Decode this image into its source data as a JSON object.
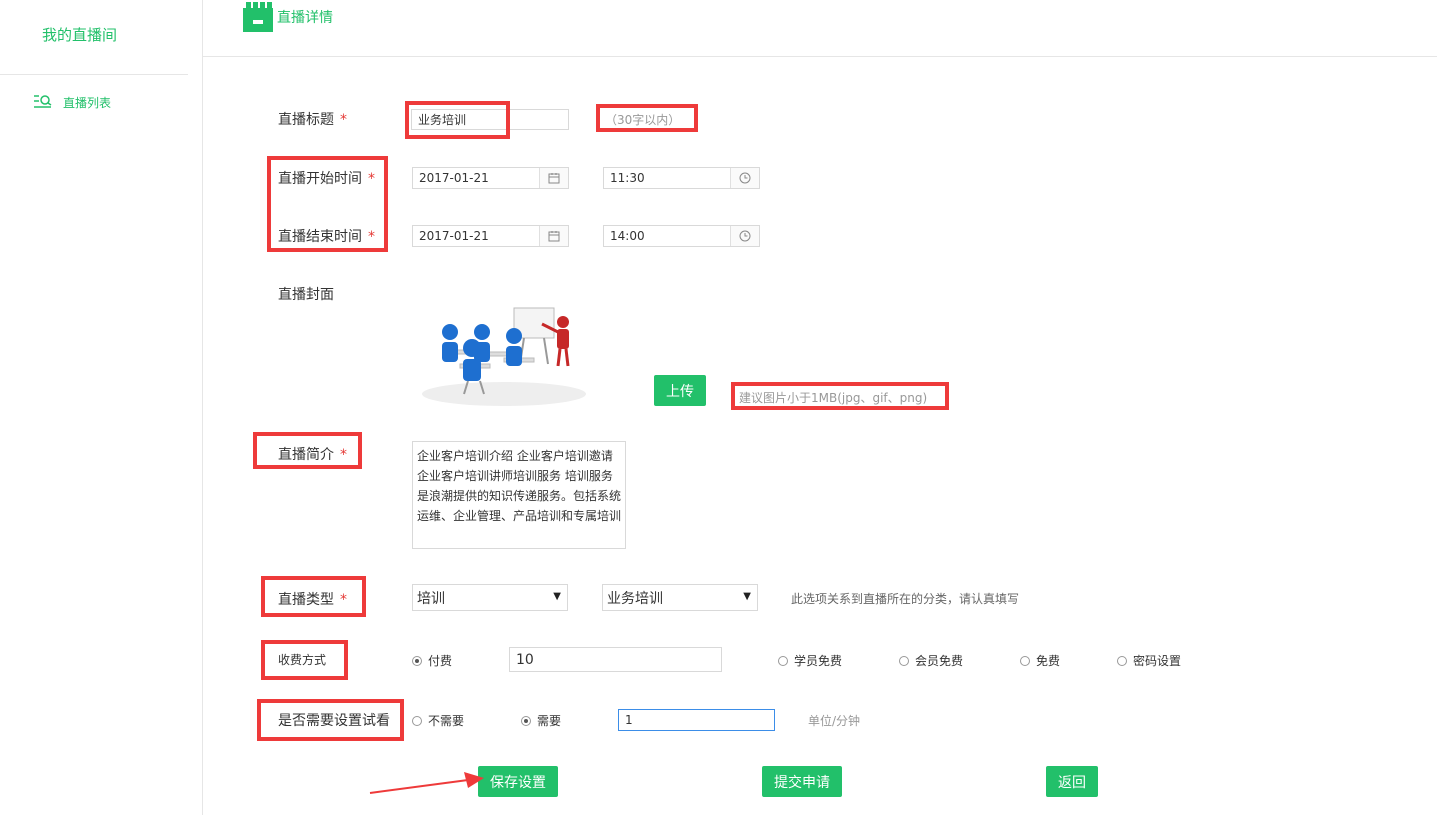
{
  "sidebar": {
    "title": "我的直播间",
    "items": [
      {
        "label": "直播列表",
        "icon": "search-list-icon"
      }
    ]
  },
  "header": {
    "title": "直播详情",
    "icon": "store-icon"
  },
  "form": {
    "title_label": "直播标题",
    "title_value": "业务培训",
    "title_hint": "（30字以内）",
    "start_label": "直播开始时间",
    "start_date": "2017-01-21",
    "start_time": "11:30",
    "end_label": "直播结束时间",
    "end_date": "2017-01-21",
    "end_time": "14:00",
    "cover_label": "直播封面",
    "upload_button": "上传",
    "upload_hint": "建议图片小于1MB(jpg、gif、png)",
    "intro_label": "直播简介",
    "intro_lines": [
      "企业客户培训介绍 企业客户培训邀请",
      "企业客户培训讲师培训服务 培训服务",
      "是浪潮提供的知识传递服务。包括系统",
      "运维、企业管理、产品培训和专属培训"
    ],
    "type_label": "直播类型",
    "type_value": "培训",
    "subtype_value": "业务培训",
    "type_hint": "此选项关系到直播所在的分类，请认真填写",
    "fee_label": "收费方式",
    "fee_options": [
      "付费",
      "学员免费",
      "会员免费",
      "免费",
      "密码设置"
    ],
    "fee_selected": "付费",
    "fee_value": "10",
    "trial_label": "是否需要设置试看",
    "trial_options": [
      "不需要",
      "需要"
    ],
    "trial_selected": "需要",
    "trial_value": "1",
    "trial_unit": "单位/分钟",
    "required_mark": "*"
  },
  "actions": {
    "save": "保存设置",
    "submit": "提交申请",
    "back": "返回"
  },
  "colors": {
    "accent": "#22c06a",
    "annotation": "#ee3a3a"
  }
}
